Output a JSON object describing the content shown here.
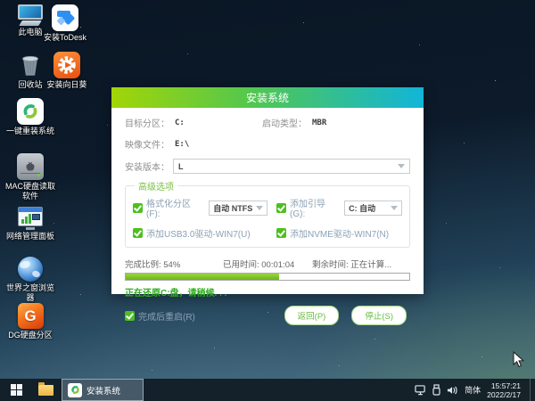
{
  "desktop": {
    "icons": [
      {
        "name": "this-pc",
        "label": "此电脑"
      },
      {
        "name": "todesk",
        "label": "安装ToDesk"
      },
      {
        "name": "recycle-bin",
        "label": "回收站"
      },
      {
        "name": "sunflower",
        "label": "安装向日葵"
      },
      {
        "name": "reinstall",
        "label": "一键重装系统"
      },
      {
        "name": "mac-disk",
        "label": "MAC硬盘读取软件"
      },
      {
        "name": "network-panel",
        "label": "网络管理面板"
      },
      {
        "name": "browser",
        "label": "世界之窗浏览器"
      },
      {
        "name": "diskgenius",
        "label": "DG硬盘分区"
      }
    ],
    "dg_glyph": "G"
  },
  "dialog": {
    "title": "安装系统",
    "fields": {
      "target_partition_label": "目标分区：",
      "target_partition_value": "C:",
      "boot_type_label": "启动类型：",
      "boot_type_value": "MBR",
      "image_file_label": "映像文件：",
      "image_file_value": "E:\\",
      "install_version_label": "安装版本：",
      "install_version_value": "L"
    },
    "advanced": {
      "group_label": "高级选项",
      "format_partition_label": "格式化分区(F):",
      "format_partition_value": "自动 NTFS",
      "add_boot_label": "添加引导(G):",
      "add_boot_value": "C: 自动",
      "usb3_label": "添加USB3.0驱动-WIN7(U)",
      "nvme_label": "添加NVME驱动-WIN7(N)"
    },
    "progress": {
      "percent": 54,
      "percent_label": "完成比例: 54%",
      "elapsed_label": "已用时间: 00:01:04",
      "remaining_label": "剩余时间: 正在计算...",
      "status_text": "正在还原C:盘，请稍候. . ."
    },
    "footer": {
      "restart_label": "完成后重启(R)",
      "back_button": "返回(P)",
      "stop_button": "停止(S)"
    }
  },
  "taskbar": {
    "active_app_label": "安装系统",
    "ime_label": "简体",
    "time": "15:57:21",
    "date": "2022/2/17"
  },
  "colors": {
    "title_gradient_left": "#a2d506",
    "title_gradient_right": "#11b5d9",
    "progress_green": "#6db41c",
    "checkbox_green": "#4cc01f",
    "button_green": "#67bd41",
    "status_green": "#2fae1f"
  }
}
